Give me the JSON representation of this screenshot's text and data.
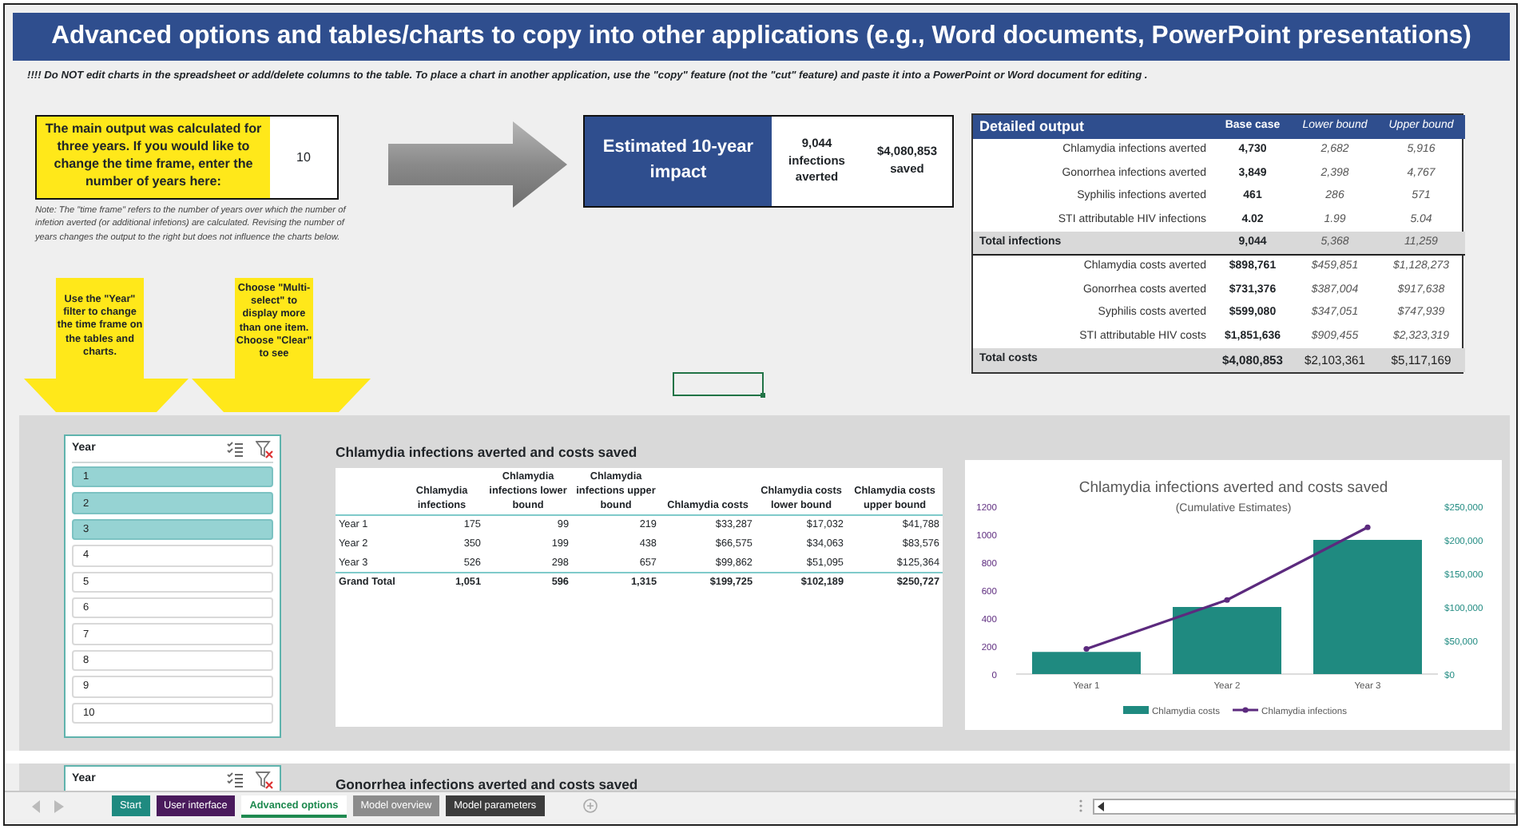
{
  "title": "Advanced options and tables/charts to copy into other applications (e.g., Word documents, PowerPoint presentations)",
  "warning": "!!!! Do NOT edit charts in the spreadsheet or add/delete columns to the table. To place a chart in another application, use the \"copy\" feature (not the \"cut\" feature) and paste it into a PowerPoint or Word document for editing .",
  "time_frame_input": {
    "label": "The main output was calculated for three years. If you would like to change the time frame, enter the number of years here:",
    "value": "10",
    "note": "Note: The \"time frame\" refers to the number of years over which the number of infetion averted (or additional infetions) are calculated. Revising the number of years changes the output to the right but does not influence the charts below."
  },
  "callouts": [
    {
      "text": "Use the \"Year\" filter to change the time frame on the tables and charts."
    },
    {
      "text": "Choose \"Multi-select\" to display more than one item. Choose \"Clear\" to see"
    }
  ],
  "impact": {
    "title": "Estimated 10-year impact",
    "infections": "9,044",
    "infections_label": "infections averted",
    "savings": "$4,080,853",
    "savings_label": "saved"
  },
  "detailed_output": {
    "title": "Detailed output",
    "columns": [
      "Base case",
      "Lower bound",
      "Upper bound"
    ],
    "rows": [
      {
        "kind": "item",
        "label": "Chlamydia infections averted",
        "values": [
          "4,730",
          "2,682",
          "5,916"
        ]
      },
      {
        "kind": "item",
        "label": "Gonorrhea infections averted",
        "values": [
          "3,849",
          "2,398",
          "4,767"
        ]
      },
      {
        "kind": "item",
        "label": "Syphilis infections averted",
        "values": [
          "461",
          "286",
          "571"
        ]
      },
      {
        "kind": "item",
        "label": "STI attributable HIV infections",
        "values": [
          "4.02",
          "1.99",
          "5.04"
        ]
      },
      {
        "kind": "total",
        "label": "Total infections",
        "values": [
          "9,044",
          "5,368",
          "11,259"
        ]
      },
      {
        "kind": "item",
        "label": "Chlamydia costs averted",
        "values": [
          "$898,761",
          "$459,851",
          "$1,128,273"
        ]
      },
      {
        "kind": "item",
        "label": "Gonorrhea costs averted",
        "values": [
          "$731,376",
          "$387,004",
          "$917,638"
        ]
      },
      {
        "kind": "item",
        "label": "Syphilis costs averted",
        "values": [
          "$599,080",
          "$347,051",
          "$747,939"
        ]
      },
      {
        "kind": "item",
        "label": "STI attributable HIV costs",
        "values": [
          "$1,851,636",
          "$909,455",
          "$2,323,319"
        ]
      },
      {
        "kind": "grand_total",
        "label": "Total costs",
        "values": [
          "$4,080,853",
          "$2,103,361",
          "$5,117,169"
        ]
      }
    ]
  },
  "year_slicers": [
    {
      "title": "Year",
      "items": [
        {
          "label": "1",
          "selected": true
        },
        {
          "label": "2",
          "selected": true
        },
        {
          "label": "3",
          "selected": true
        },
        {
          "label": "4",
          "selected": false
        },
        {
          "label": "5",
          "selected": false
        },
        {
          "label": "6",
          "selected": false
        },
        {
          "label": "7",
          "selected": false
        },
        {
          "label": "8",
          "selected": false
        },
        {
          "label": "9",
          "selected": false
        },
        {
          "label": "10",
          "selected": false
        }
      ]
    },
    {
      "title": "Year"
    }
  ],
  "chlamydia": {
    "title": "Chlamydia infections averted and costs saved",
    "columns": [
      "Chlamydia infections",
      "Chlamydia infections lower bound",
      "Chlamydia infections upper bound",
      "Chlamydia costs",
      "Chlamydia costs lower bound",
      "Chlamydia costs upper bound"
    ],
    "rows": [
      {
        "kind": "item",
        "label": "Year 1",
        "values": [
          "175",
          "99",
          "219",
          "$33,287",
          "$17,032",
          "$41,788"
        ]
      },
      {
        "kind": "item",
        "label": "Year 2",
        "values": [
          "350",
          "199",
          "438",
          "$66,575",
          "$34,063",
          "$83,576"
        ]
      },
      {
        "kind": "item",
        "label": "Year 3",
        "values": [
          "526",
          "298",
          "657",
          "$99,862",
          "$51,095",
          "$125,364"
        ]
      },
      {
        "kind": "total",
        "label": "Grand Total",
        "values": [
          "1,051",
          "596",
          "1,315",
          "$199,725",
          "$102,189",
          "$250,727"
        ]
      }
    ],
    "chart_data": {
      "type": "bar",
      "title": "Chlamydia infections averted and costs saved",
      "subtitle": "(Cumulative Estimates)",
      "categories": [
        "Year 1",
        "Year 2",
        "Year 3"
      ],
      "series": [
        {
          "name": "Chlamydia costs",
          "type": "bar",
          "axis": "y2",
          "color": "#1f8a80",
          "values": [
            33000,
            100000,
            200000
          ]
        },
        {
          "name": "Chlamydia infections",
          "type": "line",
          "axis": "y",
          "marker": "circle",
          "color": "#5c2a7e",
          "values": [
            180,
            530,
            1050
          ]
        }
      ],
      "legend": true,
      "ylim": [
        0,
        1200
      ],
      "yticks": [
        0,
        200,
        400,
        600,
        800,
        1000,
        1200
      ],
      "y2lim": [
        0,
        250000
      ],
      "y2ticks": [
        {
          "value": 0,
          "label": "$0"
        },
        {
          "value": 50000,
          "label": "$50,000"
        },
        {
          "value": 100000,
          "label": "$100,000"
        },
        {
          "value": 150000,
          "label": "$150,000"
        },
        {
          "value": 200000,
          "label": "$200,000"
        },
        {
          "value": 250000,
          "label": "$250,000"
        }
      ]
    }
  },
  "next_section_title": "Gonorrhea infections averted and costs saved",
  "sheet_tabs": [
    {
      "label": "Start",
      "color": "#1f8a80",
      "selected": false
    },
    {
      "label": "User interface",
      "color": "#4a1a5c",
      "selected": false
    },
    {
      "label": "Advanced options",
      "color": "#1f8a50",
      "selected": true
    },
    {
      "label": "Model overview",
      "color": "#8c8c8c",
      "selected": false
    },
    {
      "label": "Model parameters",
      "color": "#3c3c3c",
      "selected": false
    }
  ]
}
